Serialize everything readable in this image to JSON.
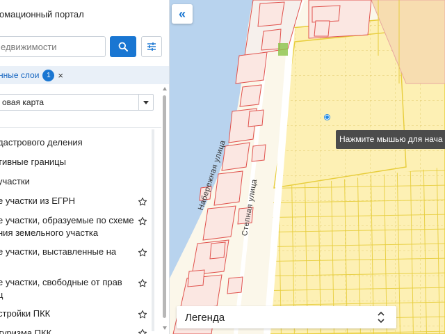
{
  "panel": {
    "title": "омационный портал",
    "search": {
      "placeholder": "едвижимости",
      "value": ""
    },
    "layers_label": "нные слои",
    "layers_count": "1",
    "layers_clear": "×",
    "basemap": "овая карта",
    "layers": [
      {
        "label": "дастрового деления",
        "starred": false
      },
      {
        "label": "тивные границы",
        "starred": false
      },
      {
        "label": "участки",
        "starred": false
      },
      {
        "label": "е участки из ЕГРН",
        "starred": true
      },
      {
        "label": "е участки, образуемые по схеме\nния земельного участка",
        "starred": true
      },
      {
        "label": "е участки, выставленные на",
        "starred": true
      },
      {
        "label": "е участки, свободные от прав\nц",
        "starred": true
      },
      {
        "label": "стройки ПКК",
        "starred": true
      },
      {
        "label": "туризма ПКК",
        "starred": true
      }
    ]
  },
  "map": {
    "collapse_icon": "«",
    "tooltip": "Нажмите мышью для нача",
    "streets": {
      "naberezhnaya": "Набережная улица",
      "stepnaya": "Степная улица"
    },
    "legend_label": "Легенда",
    "colors": {
      "water": "#b8d3ee",
      "parcel_fill": "#fbe7e2",
      "parcel_stroke": "#e0524d",
      "zone_fill": "#fdf0b4",
      "zone_stroke": "#e7cd3b"
    }
  }
}
